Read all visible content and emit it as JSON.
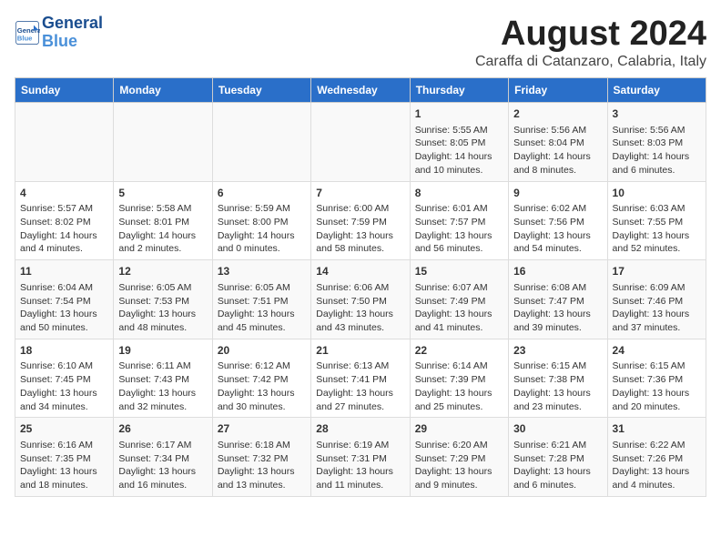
{
  "logo": {
    "name": "General",
    "name2": "Blue"
  },
  "title": "August 2024",
  "subtitle": "Caraffa di Catanzaro, Calabria, Italy",
  "headers": [
    "Sunday",
    "Monday",
    "Tuesday",
    "Wednesday",
    "Thursday",
    "Friday",
    "Saturday"
  ],
  "weeks": [
    [
      {
        "day": "",
        "content": ""
      },
      {
        "day": "",
        "content": ""
      },
      {
        "day": "",
        "content": ""
      },
      {
        "day": "",
        "content": ""
      },
      {
        "day": "1",
        "content": "Sunrise: 5:55 AM\nSunset: 8:05 PM\nDaylight: 14 hours\nand 10 minutes."
      },
      {
        "day": "2",
        "content": "Sunrise: 5:56 AM\nSunset: 8:04 PM\nDaylight: 14 hours\nand 8 minutes."
      },
      {
        "day": "3",
        "content": "Sunrise: 5:56 AM\nSunset: 8:03 PM\nDaylight: 14 hours\nand 6 minutes."
      }
    ],
    [
      {
        "day": "4",
        "content": "Sunrise: 5:57 AM\nSunset: 8:02 PM\nDaylight: 14 hours\nand 4 minutes."
      },
      {
        "day": "5",
        "content": "Sunrise: 5:58 AM\nSunset: 8:01 PM\nDaylight: 14 hours\nand 2 minutes."
      },
      {
        "day": "6",
        "content": "Sunrise: 5:59 AM\nSunset: 8:00 PM\nDaylight: 14 hours\nand 0 minutes."
      },
      {
        "day": "7",
        "content": "Sunrise: 6:00 AM\nSunset: 7:59 PM\nDaylight: 13 hours\nand 58 minutes."
      },
      {
        "day": "8",
        "content": "Sunrise: 6:01 AM\nSunset: 7:57 PM\nDaylight: 13 hours\nand 56 minutes."
      },
      {
        "day": "9",
        "content": "Sunrise: 6:02 AM\nSunset: 7:56 PM\nDaylight: 13 hours\nand 54 minutes."
      },
      {
        "day": "10",
        "content": "Sunrise: 6:03 AM\nSunset: 7:55 PM\nDaylight: 13 hours\nand 52 minutes."
      }
    ],
    [
      {
        "day": "11",
        "content": "Sunrise: 6:04 AM\nSunset: 7:54 PM\nDaylight: 13 hours\nand 50 minutes."
      },
      {
        "day": "12",
        "content": "Sunrise: 6:05 AM\nSunset: 7:53 PM\nDaylight: 13 hours\nand 48 minutes."
      },
      {
        "day": "13",
        "content": "Sunrise: 6:05 AM\nSunset: 7:51 PM\nDaylight: 13 hours\nand 45 minutes."
      },
      {
        "day": "14",
        "content": "Sunrise: 6:06 AM\nSunset: 7:50 PM\nDaylight: 13 hours\nand 43 minutes."
      },
      {
        "day": "15",
        "content": "Sunrise: 6:07 AM\nSunset: 7:49 PM\nDaylight: 13 hours\nand 41 minutes."
      },
      {
        "day": "16",
        "content": "Sunrise: 6:08 AM\nSunset: 7:47 PM\nDaylight: 13 hours\nand 39 minutes."
      },
      {
        "day": "17",
        "content": "Sunrise: 6:09 AM\nSunset: 7:46 PM\nDaylight: 13 hours\nand 37 minutes."
      }
    ],
    [
      {
        "day": "18",
        "content": "Sunrise: 6:10 AM\nSunset: 7:45 PM\nDaylight: 13 hours\nand 34 minutes."
      },
      {
        "day": "19",
        "content": "Sunrise: 6:11 AM\nSunset: 7:43 PM\nDaylight: 13 hours\nand 32 minutes."
      },
      {
        "day": "20",
        "content": "Sunrise: 6:12 AM\nSunset: 7:42 PM\nDaylight: 13 hours\nand 30 minutes."
      },
      {
        "day": "21",
        "content": "Sunrise: 6:13 AM\nSunset: 7:41 PM\nDaylight: 13 hours\nand 27 minutes."
      },
      {
        "day": "22",
        "content": "Sunrise: 6:14 AM\nSunset: 7:39 PM\nDaylight: 13 hours\nand 25 minutes."
      },
      {
        "day": "23",
        "content": "Sunrise: 6:15 AM\nSunset: 7:38 PM\nDaylight: 13 hours\nand 23 minutes."
      },
      {
        "day": "24",
        "content": "Sunrise: 6:15 AM\nSunset: 7:36 PM\nDaylight: 13 hours\nand 20 minutes."
      }
    ],
    [
      {
        "day": "25",
        "content": "Sunrise: 6:16 AM\nSunset: 7:35 PM\nDaylight: 13 hours\nand 18 minutes."
      },
      {
        "day": "26",
        "content": "Sunrise: 6:17 AM\nSunset: 7:34 PM\nDaylight: 13 hours\nand 16 minutes."
      },
      {
        "day": "27",
        "content": "Sunrise: 6:18 AM\nSunset: 7:32 PM\nDaylight: 13 hours\nand 13 minutes."
      },
      {
        "day": "28",
        "content": "Sunrise: 6:19 AM\nSunset: 7:31 PM\nDaylight: 13 hours\nand 11 minutes."
      },
      {
        "day": "29",
        "content": "Sunrise: 6:20 AM\nSunset: 7:29 PM\nDaylight: 13 hours\nand 9 minutes."
      },
      {
        "day": "30",
        "content": "Sunrise: 6:21 AM\nSunset: 7:28 PM\nDaylight: 13 hours\nand 6 minutes."
      },
      {
        "day": "31",
        "content": "Sunrise: 6:22 AM\nSunset: 7:26 PM\nDaylight: 13 hours\nand 4 minutes."
      }
    ]
  ]
}
